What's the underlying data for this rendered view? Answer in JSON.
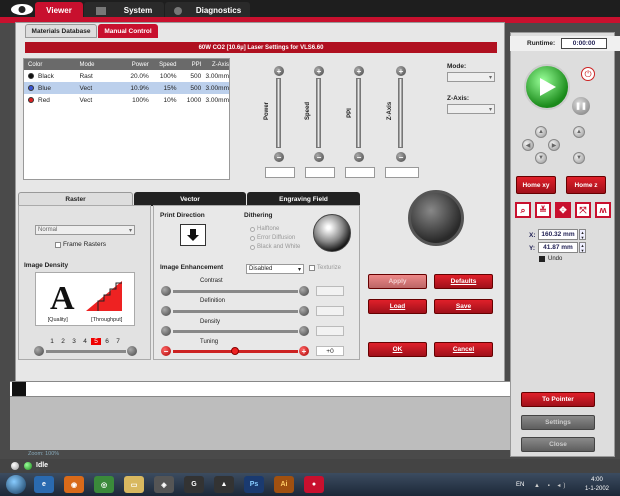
{
  "top_tabs": {
    "viewer": "Viewer",
    "system": "System",
    "diagnostics": "Diagnostics"
  },
  "sub_tabs": {
    "materials": "Materials Database",
    "manual": "Manual Control"
  },
  "settings_title": "60W CO2 [10.6µ] Laser Settings for VLS6.60",
  "table": {
    "headers": [
      "Color",
      "Mode",
      "Power",
      "Speed",
      "PPI",
      "Z-Axis"
    ],
    "rows": [
      {
        "color": "Black",
        "mode": "Rast",
        "power": "20.0%",
        "speed": "100%",
        "ppi": "500",
        "z": "3.00mm",
        "dot": "#111111"
      },
      {
        "color": "Blue",
        "mode": "Vect",
        "power": "10.9%",
        "speed": "15%",
        "ppi": "500",
        "z": "3.00mm",
        "dot": "#3a56d4"
      },
      {
        "color": "Red",
        "mode": "Vect",
        "power": "100%",
        "speed": "10%",
        "ppi": "1000",
        "z": "3.00mm",
        "dot": "#dd2222"
      }
    ]
  },
  "sliders": {
    "power": "Power",
    "speed": "Speed",
    "ppi": "PPI",
    "zaxis": "Z-Axis"
  },
  "mode_label": "Mode:",
  "zaxis_label": "Z-Axis:",
  "section_tabs": {
    "raster": "Raster",
    "vector": "Vector",
    "engraving": "Engraving Field"
  },
  "raster": {
    "normal": "Normal",
    "frame_rasters": "Frame Rasters",
    "image_density": "Image Density",
    "quality": "[Quality]",
    "throughput": "[Throughput]",
    "density_levels": [
      "1",
      "2",
      "3",
      "4",
      "5",
      "6",
      "7"
    ]
  },
  "print_direction": "Print Direction",
  "dithering": {
    "title": "Dithering",
    "halftone": "Halftone",
    "error_diffusion": "Error Diffusion",
    "black_white": "Black and White"
  },
  "enhancement": {
    "title": "Image Enhancement",
    "select": "Disabled",
    "texturize": "Texturize",
    "contrast": "Contrast",
    "definition": "Definition",
    "density": "Density",
    "tuning": "Tuning",
    "tuning_value": "+0"
  },
  "buttons": {
    "apply": "Apply",
    "defaults": "Defaults",
    "load": "Load",
    "save": "Save",
    "ok": "OK",
    "cancel": "Cancel"
  },
  "right": {
    "runtime_label": "Runtime:",
    "runtime_value": "0:00:00",
    "home_xy": "Home xy",
    "home_z": "Home z",
    "x_label": "X:",
    "x_value": "160.32 mm",
    "y_label": "Y:",
    "y_value": "41.87 mm",
    "undo": "Undo",
    "to_pointer": "To Pointer",
    "settings": "Settings",
    "close": "Close"
  },
  "zoom": "Zoom: 100%",
  "status": "Idle",
  "taskbar": {
    "lang": "EN",
    "time": "4:00",
    "date": "1-1-2002"
  }
}
